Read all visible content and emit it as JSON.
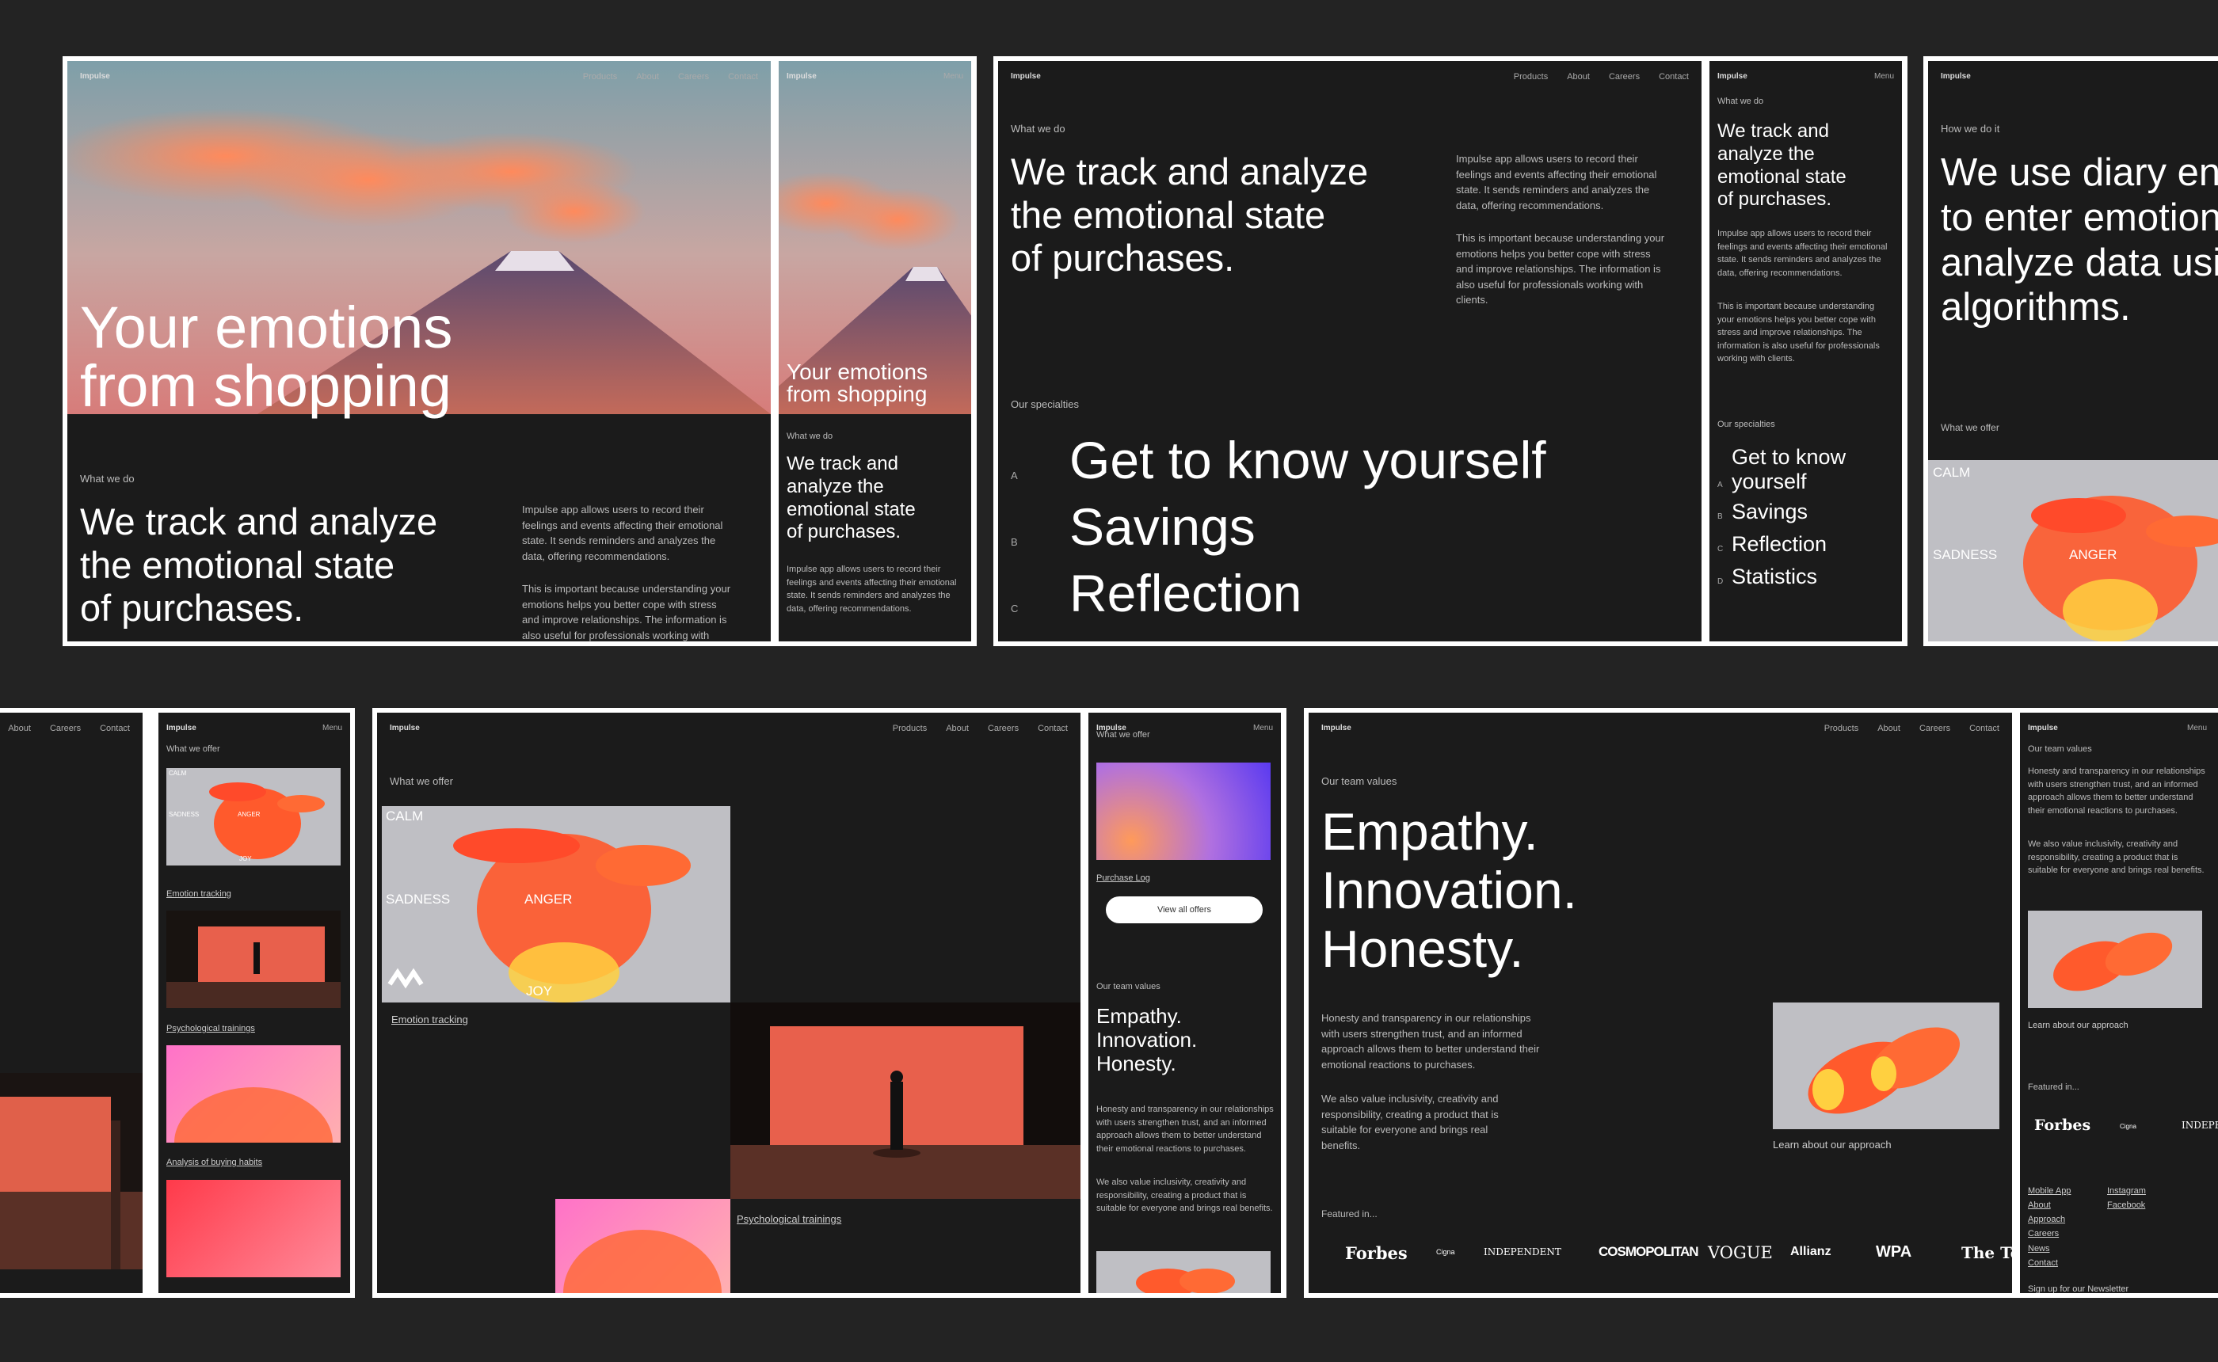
{
  "brand": "Impulse",
  "menu_label": "Menu",
  "nav": [
    "Products",
    "About",
    "Careers",
    "Contact"
  ],
  "hero": {
    "line1": "Your emotions",
    "line2": "from shopping"
  },
  "what_we_do": {
    "label": "What we do",
    "heading": "We track and analyze the emotional state of purchases.",
    "heading_lines": [
      "We track and analyze",
      "the emotional state",
      "of purchases."
    ],
    "heading_lines_mobile": [
      "We track and",
      "analyze the",
      "emotional state",
      "of purchases."
    ],
    "para1": "Impulse app allows users to record their feelings and events affecting their emotional state. It sends reminders and analyzes the data, offering recommendations.",
    "para2": "This is important because understanding your emotions helps you better cope with stress and improve relationships. The information is also useful for professionals working with clients."
  },
  "specialties": {
    "label": "Our specialties",
    "items": [
      {
        "letter": "A",
        "text": "Get to know yourself"
      },
      {
        "letter": "B",
        "text": "Savings"
      },
      {
        "letter": "C",
        "text": "Reflection"
      },
      {
        "letter": "D",
        "text": "Statistics"
      }
    ]
  },
  "how_we_do_it": {
    "label": "How we do it",
    "lines": [
      "We use diary entr",
      "to enter emotions",
      "analyze data usin",
      "algorithms."
    ]
  },
  "offer": {
    "label": "What we offer",
    "emotions": [
      "CALM",
      "SADNESS",
      "ANGER",
      "JOY"
    ],
    "links": [
      "Emotion tracking",
      "Psychological trainings",
      "Analysis of buying habits",
      "Purchase Log"
    ],
    "view_all": "View all offers"
  },
  "values": {
    "label": "Our team values",
    "lines": [
      "Empathy.",
      "Innovation.",
      "Honesty."
    ],
    "para1": "Honesty and transparency in our relationships with users strengthen trust, and an informed approach allows them to better understand their emotional reactions to purchases.",
    "para2": "We also value inclusivity, creativity and responsibility, creating a product that is suitable for everyone and brings real benefits.",
    "approach_link": "Learn about our approach"
  },
  "featured": {
    "label": "Featured in...",
    "label_mobile": "Featured in...",
    "logos": [
      "Forbes",
      "Cigna",
      "INDEPENDENT",
      "COSMOPOLITAN",
      "VOGUE",
      "Allianz",
      "WPA",
      "The Te"
    ]
  },
  "footer": {
    "col1": [
      "Mobile App",
      "About",
      "Approach",
      "Careers",
      "News",
      "Contact"
    ],
    "col2": [
      "Instagram",
      "Facebook"
    ],
    "newsletter": "Sign up for our Newsletter"
  },
  "colors": {
    "bg": "#232323",
    "screen": "#1b1b1b",
    "accent": "#ff5a3c",
    "frame": "#ffffff"
  }
}
